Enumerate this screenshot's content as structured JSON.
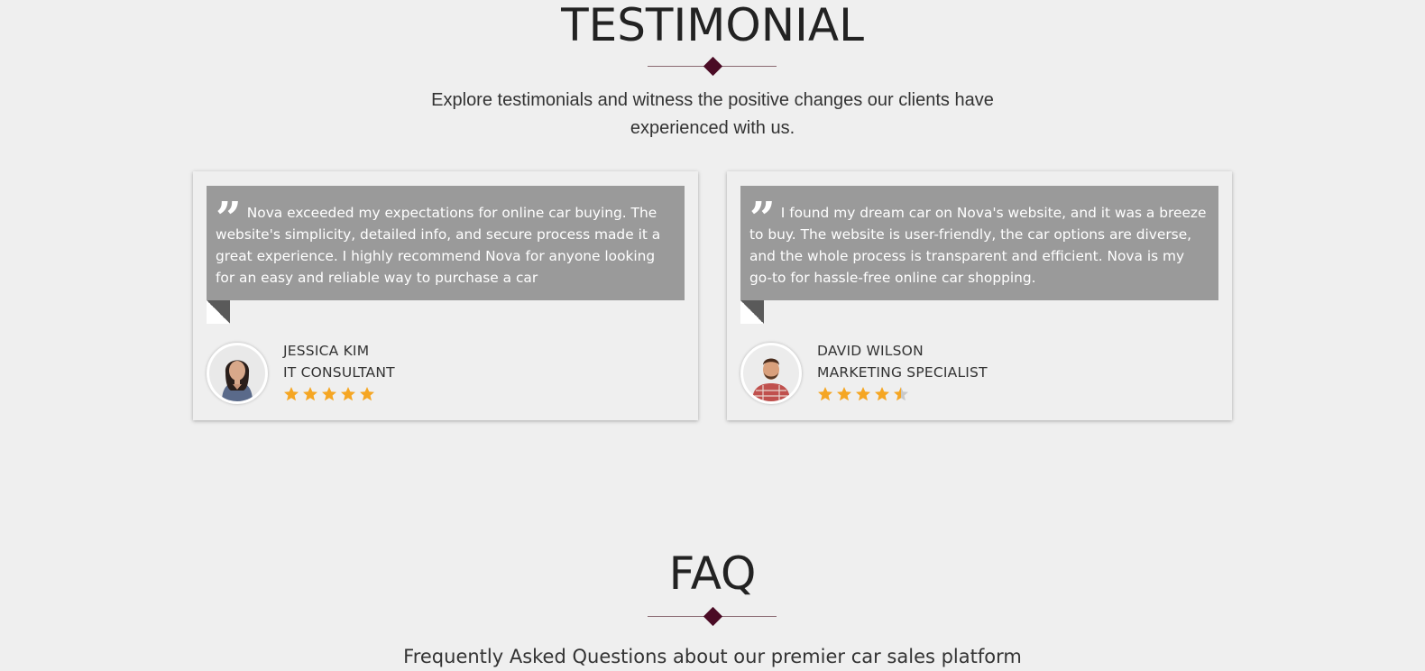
{
  "testimonial": {
    "title": "TESTIMONIAL",
    "subtitle_line1": "Explore testimonials and witness the positive changes our clients have",
    "subtitle_line2": "experienced with us.",
    "items": [
      {
        "quote": "Nova exceeded my expectations for online car buying. The website's simplicity, detailed info, and secure process made it a great experience. I highly recommend Nova for anyone looking for an easy and reliable way to purchase a car",
        "name": "JESSICA KIM",
        "role": "IT CONSULTANT",
        "rating": 5
      },
      {
        "quote": "I found my dream car on Nova's website, and it was a breeze to buy. The website is user-friendly, the car options are diverse, and the whole process is transparent and efficient. Nova is my go-to for hassle-free online car shopping.",
        "name": "DAVID WILSON",
        "role": "MARKETING SPECIALIST",
        "rating": 4.5
      }
    ]
  },
  "faq": {
    "title": "FAQ",
    "subtitle": "Frequently Asked Questions about our premier car sales platform"
  },
  "colors": {
    "accent": "#4a0b25",
    "quote_bg": "#9a9a9a",
    "star": "#f5a623",
    "star_empty": "#c9c9c9"
  },
  "icons": {
    "quote": "quote-icon",
    "star": "star-icon",
    "divider": "diamond-icon"
  }
}
